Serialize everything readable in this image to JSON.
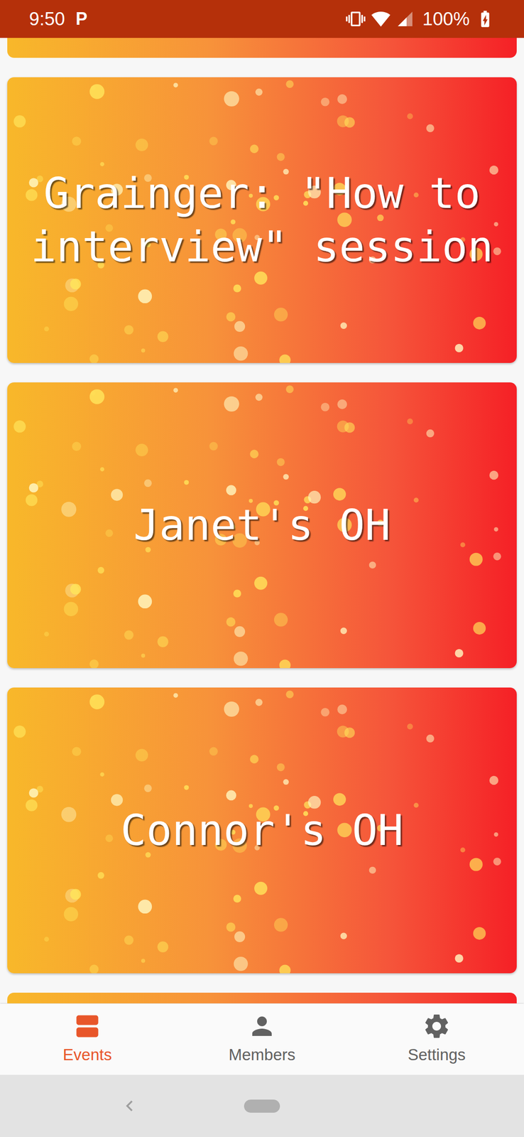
{
  "status_bar": {
    "time": "9:50",
    "notifications": [
      "P"
    ],
    "battery": "100%",
    "charging": true
  },
  "events": [
    {
      "title": "Grainger: \"How to interview\" session"
    },
    {
      "title": "Janet's OH"
    },
    {
      "title": "Connor's OH"
    }
  ],
  "bottom_nav": [
    {
      "label": "Events",
      "selected": true
    },
    {
      "label": "Members",
      "selected": false
    },
    {
      "label": "Settings",
      "selected": false
    }
  ]
}
